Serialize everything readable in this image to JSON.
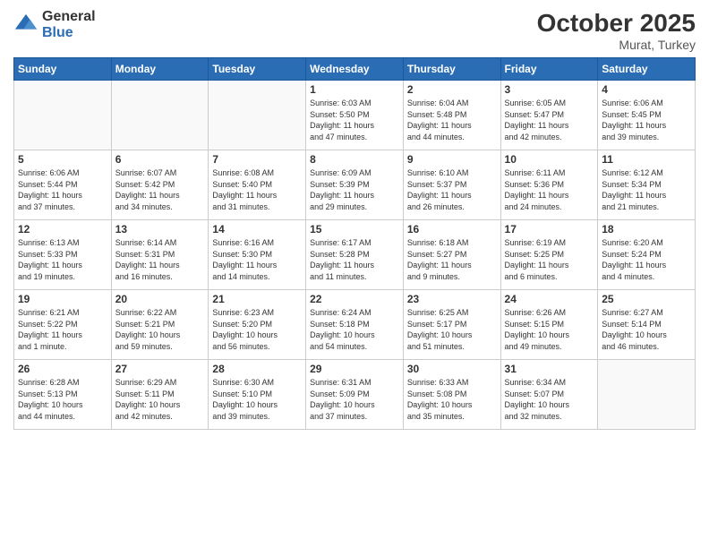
{
  "logo": {
    "general": "General",
    "blue": "Blue"
  },
  "header": {
    "month": "October 2025",
    "location": "Murat, Turkey"
  },
  "days_of_week": [
    "Sunday",
    "Monday",
    "Tuesday",
    "Wednesday",
    "Thursday",
    "Friday",
    "Saturday"
  ],
  "weeks": [
    [
      {
        "day": "",
        "info": ""
      },
      {
        "day": "",
        "info": ""
      },
      {
        "day": "",
        "info": ""
      },
      {
        "day": "1",
        "info": "Sunrise: 6:03 AM\nSunset: 5:50 PM\nDaylight: 11 hours\nand 47 minutes."
      },
      {
        "day": "2",
        "info": "Sunrise: 6:04 AM\nSunset: 5:48 PM\nDaylight: 11 hours\nand 44 minutes."
      },
      {
        "day": "3",
        "info": "Sunrise: 6:05 AM\nSunset: 5:47 PM\nDaylight: 11 hours\nand 42 minutes."
      },
      {
        "day": "4",
        "info": "Sunrise: 6:06 AM\nSunset: 5:45 PM\nDaylight: 11 hours\nand 39 minutes."
      }
    ],
    [
      {
        "day": "5",
        "info": "Sunrise: 6:06 AM\nSunset: 5:44 PM\nDaylight: 11 hours\nand 37 minutes."
      },
      {
        "day": "6",
        "info": "Sunrise: 6:07 AM\nSunset: 5:42 PM\nDaylight: 11 hours\nand 34 minutes."
      },
      {
        "day": "7",
        "info": "Sunrise: 6:08 AM\nSunset: 5:40 PM\nDaylight: 11 hours\nand 31 minutes."
      },
      {
        "day": "8",
        "info": "Sunrise: 6:09 AM\nSunset: 5:39 PM\nDaylight: 11 hours\nand 29 minutes."
      },
      {
        "day": "9",
        "info": "Sunrise: 6:10 AM\nSunset: 5:37 PM\nDaylight: 11 hours\nand 26 minutes."
      },
      {
        "day": "10",
        "info": "Sunrise: 6:11 AM\nSunset: 5:36 PM\nDaylight: 11 hours\nand 24 minutes."
      },
      {
        "day": "11",
        "info": "Sunrise: 6:12 AM\nSunset: 5:34 PM\nDaylight: 11 hours\nand 21 minutes."
      }
    ],
    [
      {
        "day": "12",
        "info": "Sunrise: 6:13 AM\nSunset: 5:33 PM\nDaylight: 11 hours\nand 19 minutes."
      },
      {
        "day": "13",
        "info": "Sunrise: 6:14 AM\nSunset: 5:31 PM\nDaylight: 11 hours\nand 16 minutes."
      },
      {
        "day": "14",
        "info": "Sunrise: 6:16 AM\nSunset: 5:30 PM\nDaylight: 11 hours\nand 14 minutes."
      },
      {
        "day": "15",
        "info": "Sunrise: 6:17 AM\nSunset: 5:28 PM\nDaylight: 11 hours\nand 11 minutes."
      },
      {
        "day": "16",
        "info": "Sunrise: 6:18 AM\nSunset: 5:27 PM\nDaylight: 11 hours\nand 9 minutes."
      },
      {
        "day": "17",
        "info": "Sunrise: 6:19 AM\nSunset: 5:25 PM\nDaylight: 11 hours\nand 6 minutes."
      },
      {
        "day": "18",
        "info": "Sunrise: 6:20 AM\nSunset: 5:24 PM\nDaylight: 11 hours\nand 4 minutes."
      }
    ],
    [
      {
        "day": "19",
        "info": "Sunrise: 6:21 AM\nSunset: 5:22 PM\nDaylight: 11 hours\nand 1 minute."
      },
      {
        "day": "20",
        "info": "Sunrise: 6:22 AM\nSunset: 5:21 PM\nDaylight: 10 hours\nand 59 minutes."
      },
      {
        "day": "21",
        "info": "Sunrise: 6:23 AM\nSunset: 5:20 PM\nDaylight: 10 hours\nand 56 minutes."
      },
      {
        "day": "22",
        "info": "Sunrise: 6:24 AM\nSunset: 5:18 PM\nDaylight: 10 hours\nand 54 minutes."
      },
      {
        "day": "23",
        "info": "Sunrise: 6:25 AM\nSunset: 5:17 PM\nDaylight: 10 hours\nand 51 minutes."
      },
      {
        "day": "24",
        "info": "Sunrise: 6:26 AM\nSunset: 5:15 PM\nDaylight: 10 hours\nand 49 minutes."
      },
      {
        "day": "25",
        "info": "Sunrise: 6:27 AM\nSunset: 5:14 PM\nDaylight: 10 hours\nand 46 minutes."
      }
    ],
    [
      {
        "day": "26",
        "info": "Sunrise: 6:28 AM\nSunset: 5:13 PM\nDaylight: 10 hours\nand 44 minutes."
      },
      {
        "day": "27",
        "info": "Sunrise: 6:29 AM\nSunset: 5:11 PM\nDaylight: 10 hours\nand 42 minutes."
      },
      {
        "day": "28",
        "info": "Sunrise: 6:30 AM\nSunset: 5:10 PM\nDaylight: 10 hours\nand 39 minutes."
      },
      {
        "day": "29",
        "info": "Sunrise: 6:31 AM\nSunset: 5:09 PM\nDaylight: 10 hours\nand 37 minutes."
      },
      {
        "day": "30",
        "info": "Sunrise: 6:33 AM\nSunset: 5:08 PM\nDaylight: 10 hours\nand 35 minutes."
      },
      {
        "day": "31",
        "info": "Sunrise: 6:34 AM\nSunset: 5:07 PM\nDaylight: 10 hours\nand 32 minutes."
      },
      {
        "day": "",
        "info": ""
      }
    ]
  ]
}
